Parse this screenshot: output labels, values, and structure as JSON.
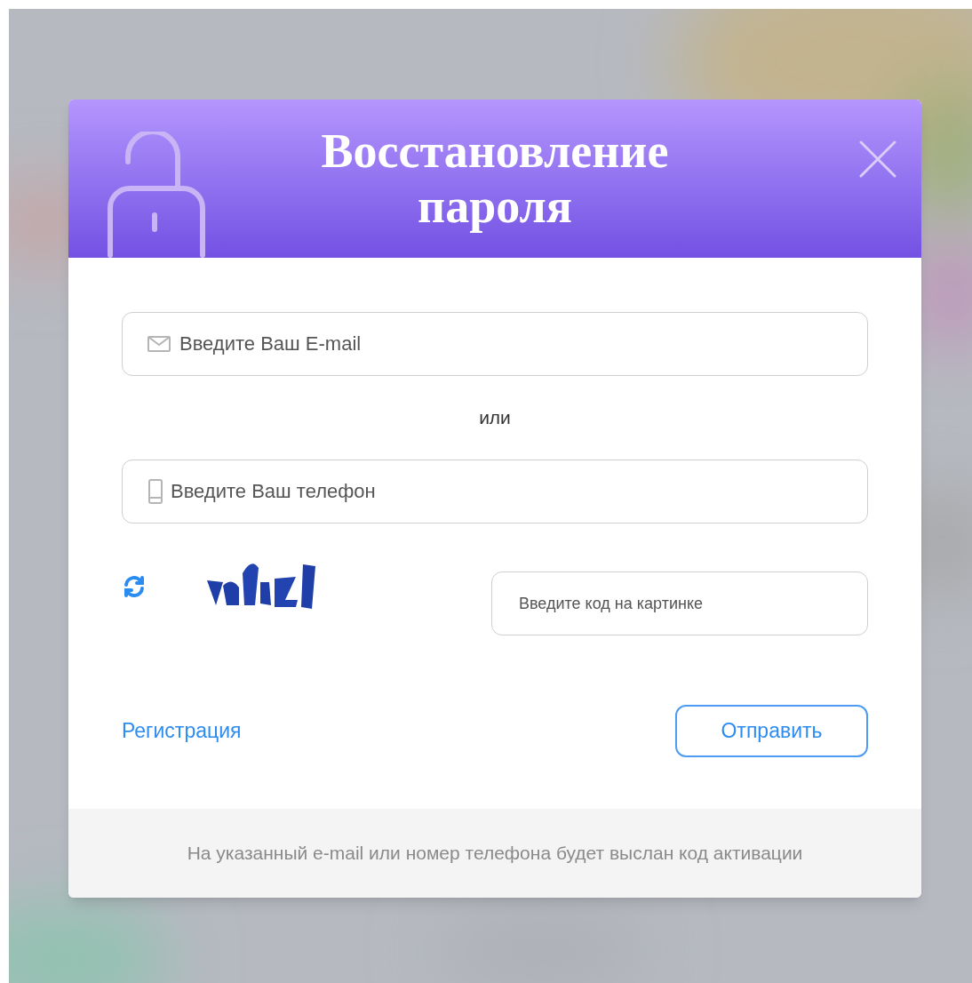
{
  "dialog": {
    "title": "Восстановление пароля",
    "email_field": {
      "placeholder": "Введите Ваш E-mail"
    },
    "separator": "или",
    "phone_field": {
      "placeholder": "Введите Ваш телефон"
    },
    "captcha": {
      "code_field": {
        "placeholder": "Введите код на картинке"
      }
    },
    "register_link": "Регистрация",
    "submit_button": "Отправить",
    "footer_note": "На указанный e-mail или номер телефона будет выслан код активации"
  }
}
